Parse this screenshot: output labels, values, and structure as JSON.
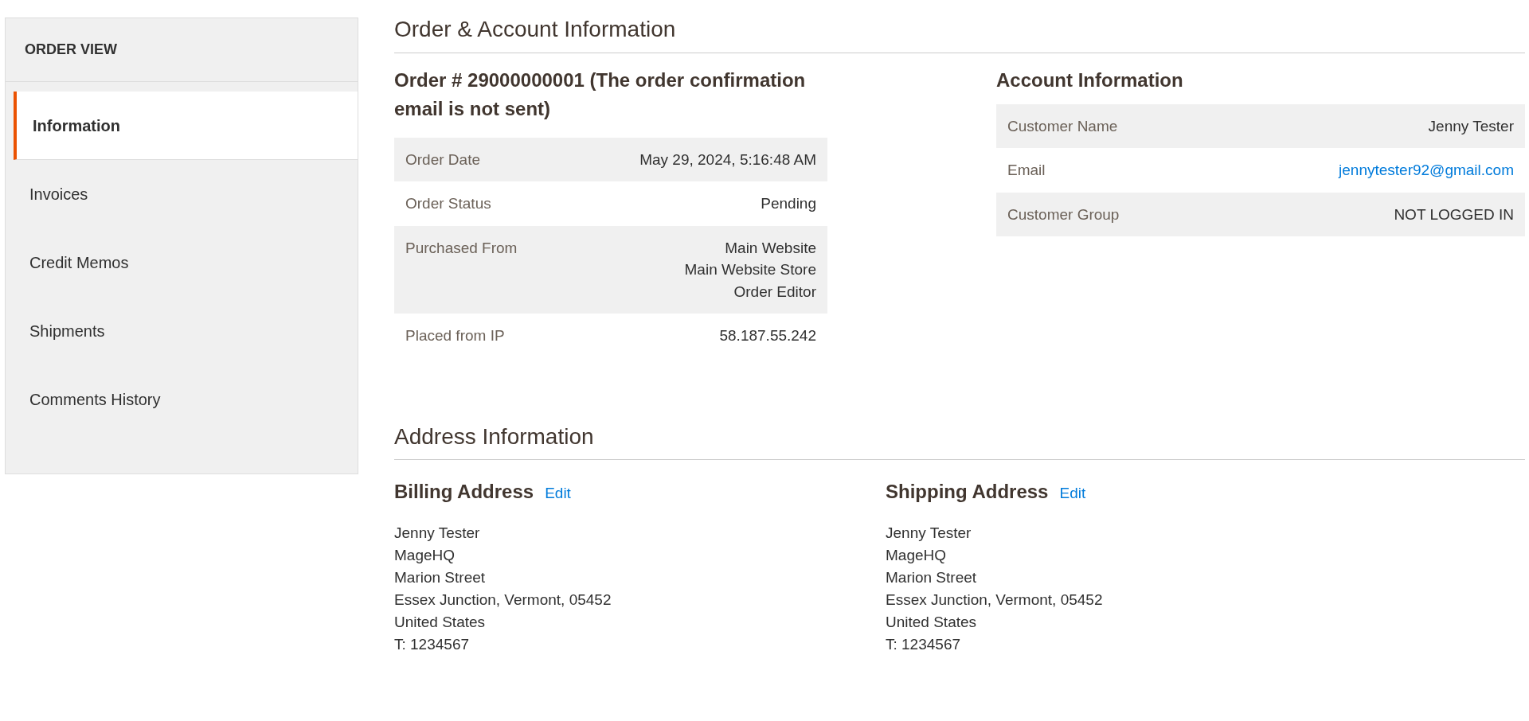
{
  "sidebar": {
    "title": "ORDER VIEW",
    "items": [
      {
        "label": "Information",
        "selected": true
      },
      {
        "label": "Invoices",
        "selected": false
      },
      {
        "label": "Credit Memos",
        "selected": false
      },
      {
        "label": "Shipments",
        "selected": false
      },
      {
        "label": "Comments History",
        "selected": false
      }
    ]
  },
  "order_account": {
    "title": "Order & Account Information",
    "order": {
      "heading": "Order # 29000000001 (The order confirmation email is not sent)",
      "rows": [
        {
          "label": "Order Date",
          "value": [
            "May 29, 2024, 5:16:48 AM"
          ]
        },
        {
          "label": "Order Status",
          "value": [
            "Pending"
          ]
        },
        {
          "label": "Purchased From",
          "value": [
            "Main Website",
            "Main Website Store",
            "Order Editor"
          ]
        },
        {
          "label": "Placed from IP",
          "value": [
            "58.187.55.242"
          ]
        }
      ]
    },
    "account": {
      "heading": "Account Information",
      "rows": [
        {
          "label": "Customer Name",
          "value": "Jenny Tester",
          "kind": "text"
        },
        {
          "label": "Email",
          "value": "jennytester92@gmail.com",
          "kind": "link"
        },
        {
          "label": "Customer Group",
          "value": "NOT LOGGED IN",
          "kind": "text"
        }
      ]
    }
  },
  "address": {
    "title": "Address Information",
    "blocks": [
      {
        "heading": "Billing Address",
        "edit": "Edit",
        "lines": [
          "Jenny Tester",
          "MageHQ",
          "Marion Street",
          "Essex Junction, Vermont, 05452",
          "United States",
          "T: 1234567"
        ]
      },
      {
        "heading": "Shipping Address",
        "edit": "Edit",
        "lines": [
          "Jenny Tester",
          "MageHQ",
          "Marion Street",
          "Essex Junction, Vermont, 05452",
          "United States",
          "T: 1234567"
        ]
      }
    ]
  }
}
